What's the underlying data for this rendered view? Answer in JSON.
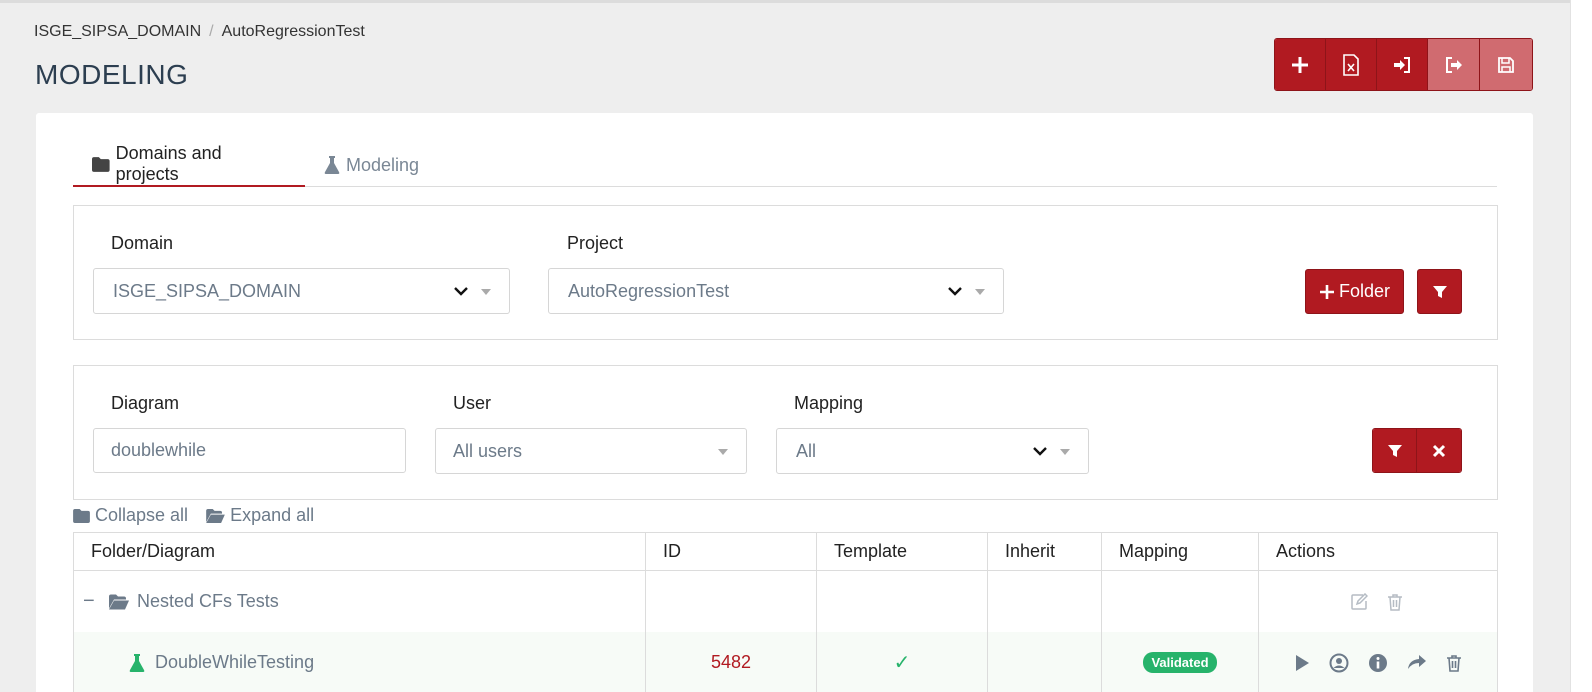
{
  "breadcrumb": {
    "domain": "ISGE_SIPSA_DOMAIN",
    "separator": "/",
    "project": "AutoRegressionTest"
  },
  "page": {
    "title": "MODELING"
  },
  "toolbar": {
    "buttons": [
      "plus-icon",
      "excel-export-icon",
      "import-icon",
      "export-icon",
      "save-icon"
    ]
  },
  "tabs": [
    {
      "label": "Domains and projects",
      "icon": "folder-icon",
      "active": true
    },
    {
      "label": "Modeling",
      "icon": "flask-icon",
      "active": false
    }
  ],
  "domain_panel": {
    "domain_label": "Domain",
    "domain_value": "ISGE_SIPSA_DOMAIN",
    "project_label": "Project",
    "project_value": "AutoRegressionTest",
    "folder_button": "Folder"
  },
  "filter_panel": {
    "diagram_label": "Diagram",
    "diagram_value": "doublewhile",
    "user_label": "User",
    "user_value": "All users",
    "mapping_label": "Mapping",
    "mapping_value": "All"
  },
  "tree_actions": {
    "collapse": "Collapse all",
    "expand": "Expand all"
  },
  "table": {
    "headers": [
      "Folder/Diagram",
      "ID",
      "Template",
      "Inherit",
      "Mapping",
      "Actions"
    ],
    "folder_row": {
      "toggle": "−",
      "name": "Nested CFs Tests"
    },
    "diagram_row": {
      "name": "DoubleWhileTesting",
      "id": "5482",
      "template": "✓",
      "mapping": "Validated"
    }
  },
  "colors": {
    "accent": "#b11a21",
    "accent_dim": "#d06b70",
    "success": "#27b36b",
    "muted": "#6c7a89"
  }
}
